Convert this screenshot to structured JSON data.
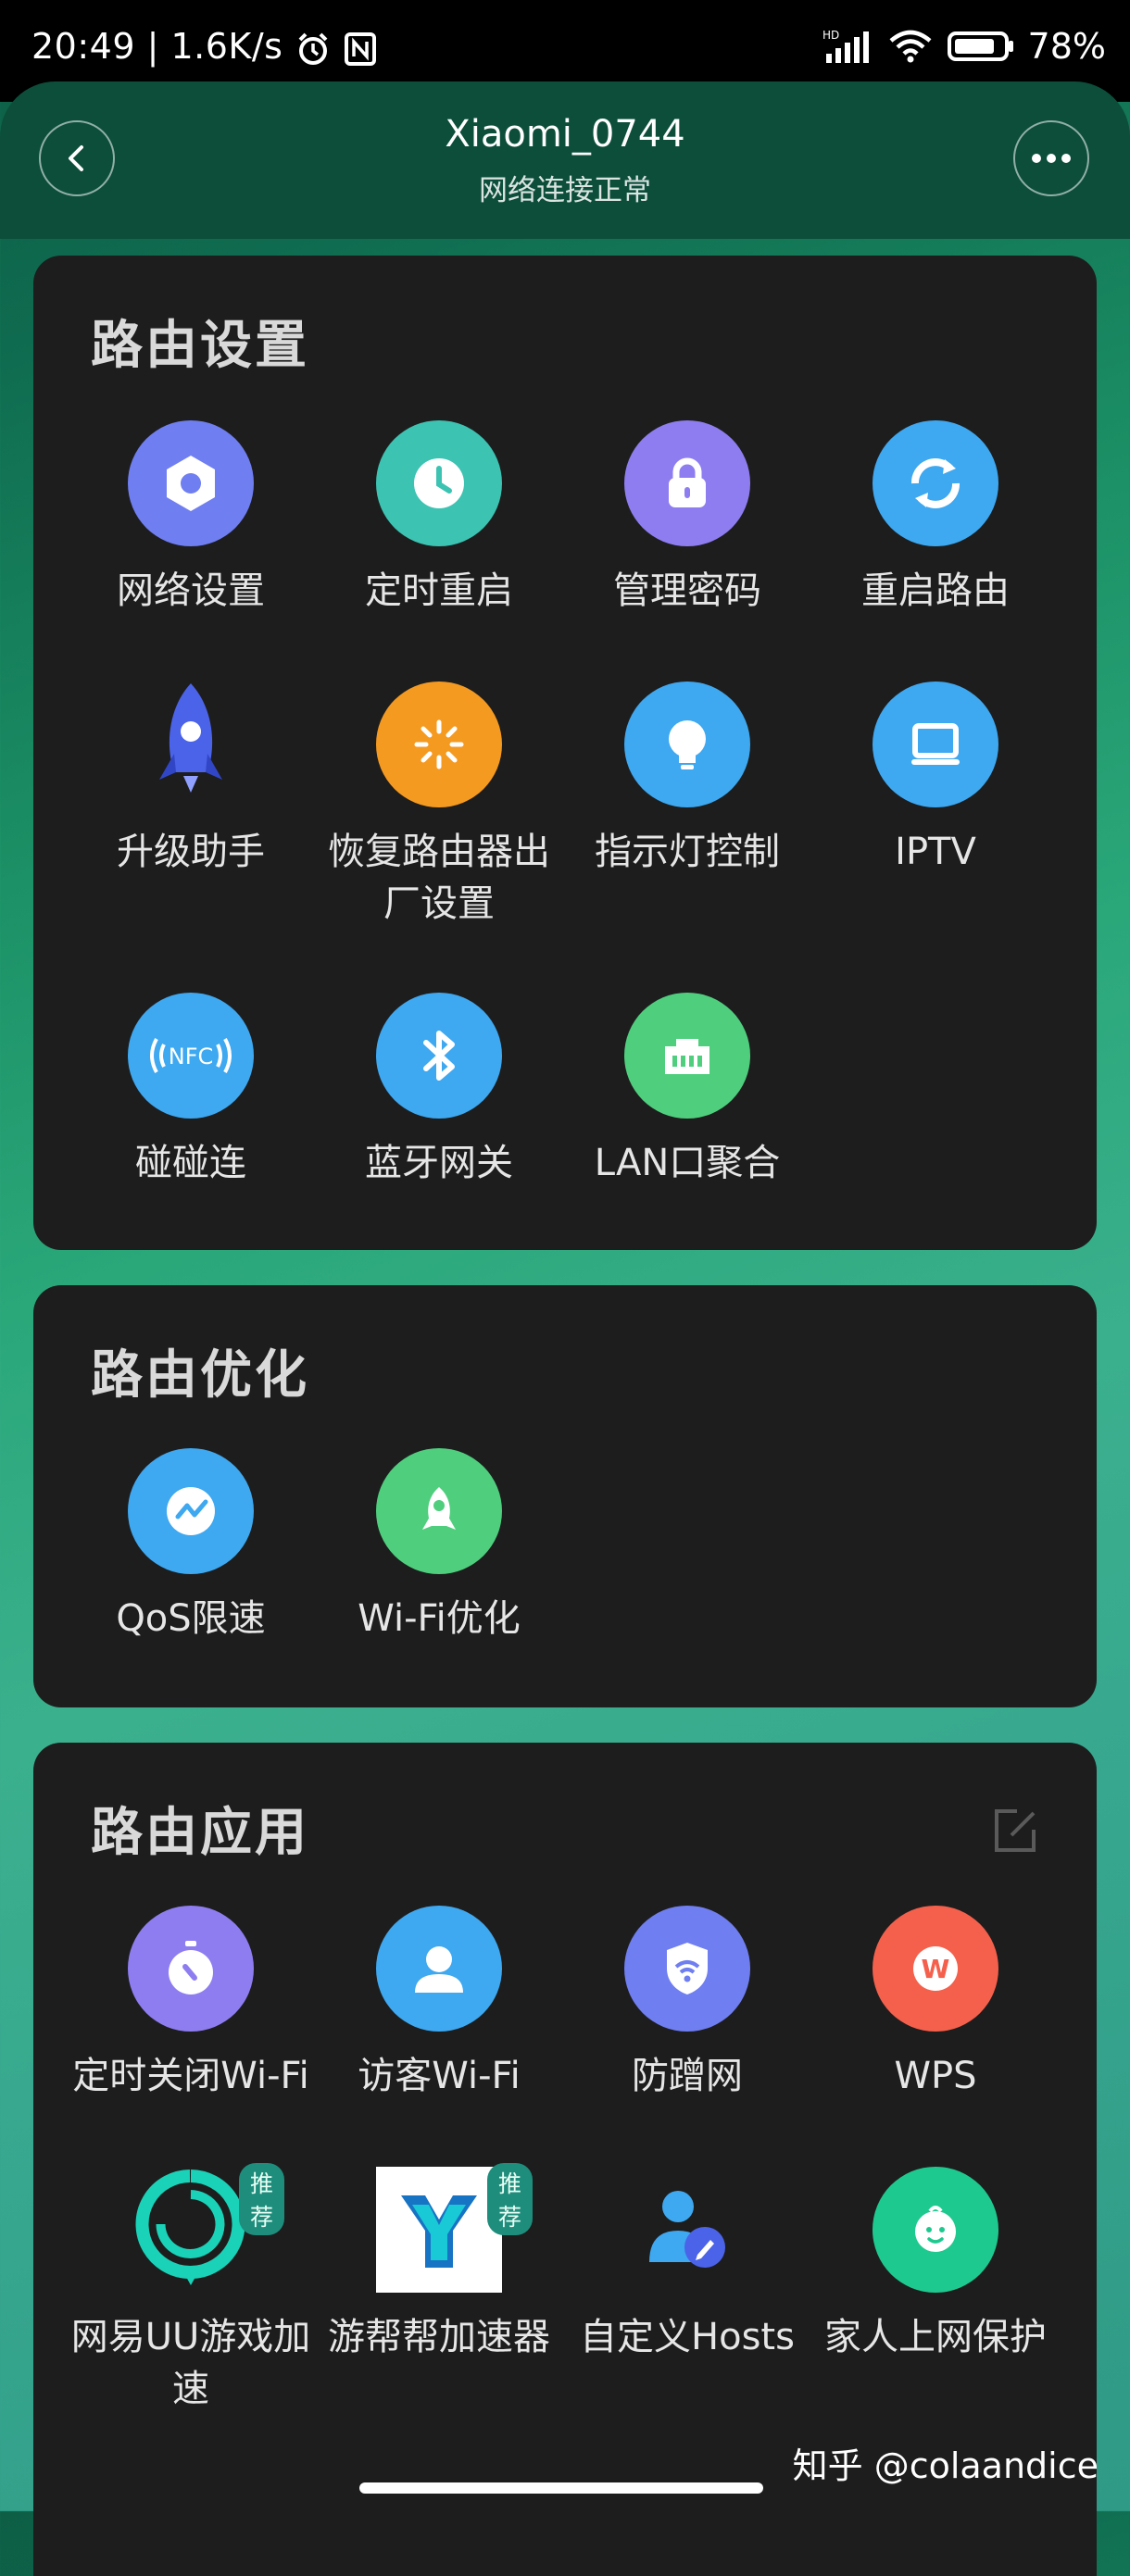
{
  "status_bar": {
    "time": "20:49",
    "speed": "1.6K/s",
    "battery": "78%",
    "icons": [
      "alarm-icon",
      "nfc-icon",
      "signal-icon",
      "wifi-icon",
      "battery-icon"
    ]
  },
  "header": {
    "title": "Xiaomi_0744",
    "subtitle": "网络连接正常",
    "back_icon": "back-icon",
    "more_icon": "more-icon"
  },
  "sections": {
    "settings": {
      "title": "路由设置",
      "items": [
        {
          "label": "网络设置",
          "icon": "hexagon-nut-icon",
          "color": "#6f7ef0"
        },
        {
          "label": "定时重启",
          "icon": "clock-icon",
          "color": "#3cc3b2"
        },
        {
          "label": "管理密码",
          "icon": "lock-icon",
          "color": "#8e7df0"
        },
        {
          "label": "重启路由",
          "icon": "refresh-icon",
          "color": "#3ea8f0"
        },
        {
          "label": "升级助手",
          "icon": "rocket-icon",
          "color": "#4b63e8"
        },
        {
          "label": "恢复路由器出厂设置",
          "icon": "reset-icon",
          "color": "#f59a21"
        },
        {
          "label": "指示灯控制",
          "icon": "bulb-icon",
          "color": "#3ea8f0"
        },
        {
          "label": "IPTV",
          "icon": "tv-icon",
          "color": "#3ea8f0"
        },
        {
          "label": "碰碰连",
          "icon": "nfc-icon",
          "color": "#3ea8f0"
        },
        {
          "label": "蓝牙网关",
          "icon": "bluetooth-icon",
          "color": "#3ea8f0"
        },
        {
          "label": "LAN口聚合",
          "icon": "lan-port-icon",
          "color": "#4fcf7e"
        }
      ]
    },
    "optimize": {
      "title": "路由优化",
      "items": [
        {
          "label": "QoS限速",
          "icon": "speed-chart-icon",
          "color": "#3ea8f0"
        },
        {
          "label": "Wi-Fi优化",
          "icon": "rocket-badge-icon",
          "color": "#4fcf7e"
        }
      ]
    },
    "apps": {
      "title": "路由应用",
      "edit_icon": "edit-icon",
      "items": [
        {
          "label": "定时关闭Wi-Fi",
          "icon": "timer-icon",
          "color": "#8e7df0"
        },
        {
          "label": "访客Wi-Fi",
          "icon": "user-icon",
          "color": "#3ea8f0"
        },
        {
          "label": "防蹭网",
          "icon": "shield-wifi-icon",
          "color": "#6f7ef0"
        },
        {
          "label": "WPS",
          "icon": "wps-icon",
          "color": "#f4604c"
        },
        {
          "label": "网易UU游戏加速",
          "icon": "uu-icon",
          "color": "#19d2b8",
          "badge": "推荐"
        },
        {
          "label": "游帮帮加速器",
          "icon": "ybb-icon",
          "color": "#ffffff",
          "badge": "推荐"
        },
        {
          "label": "自定义Hosts",
          "icon": "user-edit-icon",
          "color": "#3ea8f0"
        },
        {
          "label": "家人上网保护",
          "icon": "baby-icon",
          "color": "#1ec98f"
        }
      ]
    }
  },
  "watermark": "知乎 @colaandice"
}
